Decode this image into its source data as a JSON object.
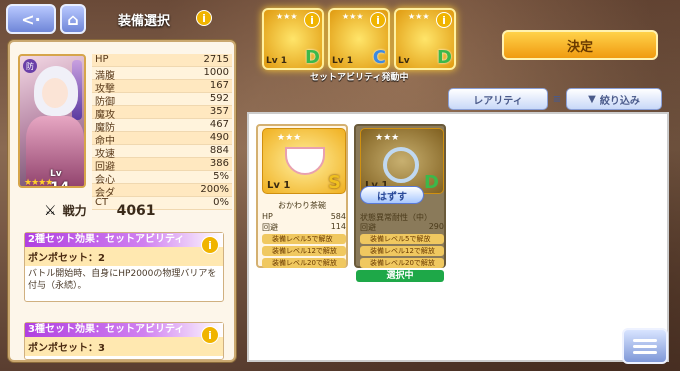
{
  "header": {
    "title": "装備選択",
    "back_icon": "back-arrow-icon",
    "home_icon": "home-icon"
  },
  "character": {
    "level_prefix": "Lv",
    "level": "14",
    "stats": [
      {
        "label": "HP",
        "value": "2715"
      },
      {
        "label": "満腹",
        "value": "1000"
      },
      {
        "label": "攻撃",
        "value": "167"
      },
      {
        "label": "防御",
        "value": "592"
      },
      {
        "label": "魔攻",
        "value": "357"
      },
      {
        "label": "魔防",
        "value": "467"
      },
      {
        "label": "命中",
        "value": "490"
      },
      {
        "label": "攻速",
        "value": "884"
      },
      {
        "label": "回避",
        "value": "386"
      },
      {
        "label": "会心",
        "value": "5%"
      },
      {
        "label": "会ダ",
        "value": "200%"
      },
      {
        "label": "CT",
        "value": "0%"
      }
    ],
    "power_label": "戦力",
    "power": "4061"
  },
  "set_effects": [
    {
      "title": "2種セット効果：セットアビリティ",
      "name": "ポンポセット：2",
      "description": "バトル開始時、自身にHP2000の物理バリアを付与（永続）。"
    },
    {
      "title": "3種セット効果：セットアビリティ",
      "name": "ポンポセット：3",
      "description": ""
    }
  ],
  "set_slots": [
    {
      "level": "Lv 1",
      "rank": "D",
      "color": "#3cb84a"
    },
    {
      "level": "Lv 1",
      "rank": "C",
      "color": "#3c8ae0"
    },
    {
      "level": "Lv",
      "rank": "D",
      "color": "#3cb84a"
    }
  ],
  "set_active_label": "セットアビリティ発動中",
  "decide_label": "決定",
  "sort": {
    "rarity_label": "レアリティ",
    "filter_label": "絞り込み"
  },
  "equipment": [
    {
      "name": "おかわり茶碗",
      "level": "Lv 1",
      "rank": "S",
      "stats": [
        {
          "label": "HP",
          "value": "584"
        },
        {
          "label": "回避",
          "value": "114"
        }
      ],
      "conditions": [
        "装備レベル5で解放",
        "装備レベル12で解放",
        "装備レベル20で解放"
      ]
    },
    {
      "name": "",
      "level": "Lv 1",
      "rank": "D",
      "stats": [
        {
          "label": "状態異常耐性（中）",
          "value": ""
        },
        {
          "label": "回避",
          "value": "290"
        }
      ],
      "conditions": [
        "装備レベル5で解放",
        "装備レベル12で解放",
        "装備レベル20で解放"
      ],
      "remove_label": "はずす",
      "selected_label": "選択中"
    }
  ]
}
